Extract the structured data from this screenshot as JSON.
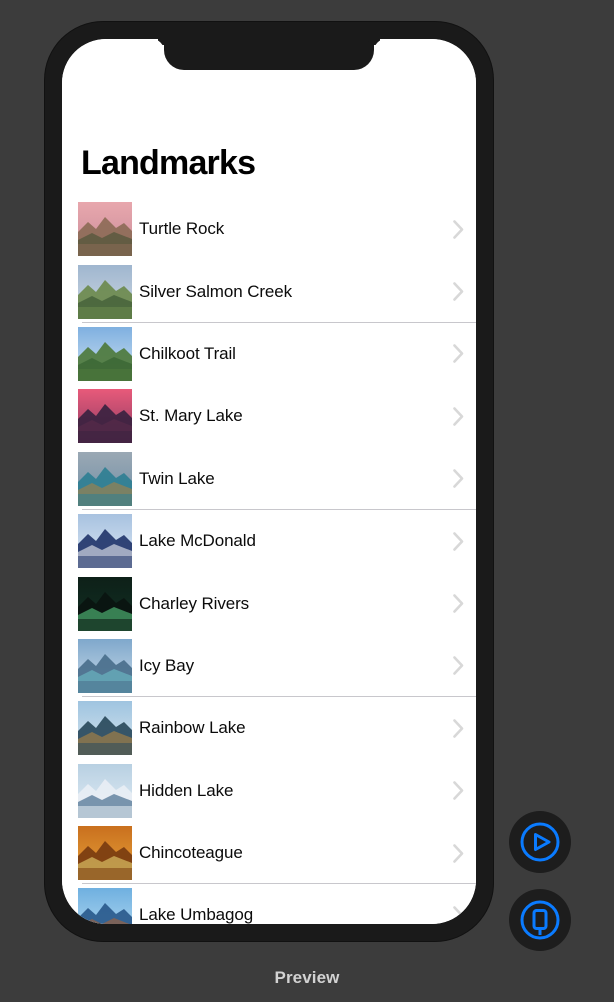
{
  "canvas": {
    "background_color": "#3c3c3c",
    "preview_label": "Preview"
  },
  "device": {
    "frame_color": "#1a1a1a",
    "screen_color": "#ffffff"
  },
  "app": {
    "nav_title": "Landmarks",
    "chevron_color": "#d8d8d8",
    "separator_color": "#c8c7cc",
    "rows": [
      {
        "label": "Turtle Rock",
        "image_name": "turtle-rock-thumbnail",
        "sky": "#e8a7ad",
        "sky2": "#c98d9a",
        "ground": "#8d6b57",
        "accent": "#3d4c2e",
        "separator": false
      },
      {
        "label": "Silver Salmon Creek",
        "image_name": "silver-salmon-creek-thumbnail",
        "sky": "#9fb6cf",
        "sky2": "#cfd8e2",
        "ground": "#6d8a4e",
        "accent": "#2d4a2a",
        "separator": true
      },
      {
        "label": "Chilkoot Trail",
        "image_name": "chilkoot-trail-thumbnail",
        "sky": "#7fb0e0",
        "sky2": "#cfe2f2",
        "ground": "#4e7a3c",
        "accent": "#2e5a2a",
        "separator": false
      },
      {
        "label": "St. Mary Lake",
        "image_name": "st-mary-lake-thumbnail",
        "sky": "#e85a7a",
        "sky2": "#8a3a62",
        "ground": "#3a2240",
        "accent": "#5c2c4a",
        "separator": false
      },
      {
        "label": "Twin Lake",
        "image_name": "twin-lake-thumbnail",
        "sky": "#9aa8b4",
        "sky2": "#6f8fa6",
        "ground": "#2f7f93",
        "accent": "#b5813c",
        "separator": true
      },
      {
        "label": "Lake McDonald",
        "image_name": "lake-mcdonald-thumbnail",
        "sky": "#a8c2e0",
        "sky2": "#dce8f4",
        "ground": "#23366b",
        "accent": "#ffffff",
        "separator": false
      },
      {
        "label": "Charley Rivers",
        "image_name": "charley-rivers-thumbnail",
        "sky": "#0d2018",
        "sky2": "#123024",
        "ground": "#0a1410",
        "accent": "#5fd98a",
        "separator": false
      },
      {
        "label": "Icy Bay",
        "image_name": "icy-bay-thumbnail",
        "sky": "#7fa8cc",
        "sky2": "#cbdbe8",
        "ground": "#4a6f8c",
        "accent": "#6fc5cc",
        "separator": true
      },
      {
        "label": "Rainbow Lake",
        "image_name": "rainbow-lake-thumbnail",
        "sky": "#9fc4e0",
        "sky2": "#d8e6ef",
        "ground": "#2a4a5c",
        "accent": "#c08a3c",
        "separator": false
      },
      {
        "label": "Hidden Lake",
        "image_name": "hidden-lake-thumbnail",
        "sky": "#b8d0e2",
        "sky2": "#e2edf5",
        "ground": "#e8eef4",
        "accent": "#1d4a72",
        "separator": false
      },
      {
        "label": "Chincoteague",
        "image_name": "chincoteague-thumbnail",
        "sky": "#c9701e",
        "sky2": "#e8a33a",
        "ground": "#7a3c10",
        "accent": "#f2e07a",
        "separator": true
      },
      {
        "label": "Lake Umbagog",
        "image_name": "lake-umbagog-thumbnail",
        "sky": "#6fb0e0",
        "sky2": "#b8dcf2",
        "ground": "#2a5a8c",
        "accent": "#b5622a",
        "separator": false
      }
    ]
  },
  "controls": {
    "accent_color": "#0a7bff",
    "background_color": "#1d1d1d",
    "buttons": [
      {
        "name": "play-button",
        "icon": "play-circle-icon",
        "label": "Live Preview"
      },
      {
        "name": "device-settings-button",
        "icon": "device-circle-icon",
        "label": "Preview on Device"
      }
    ]
  }
}
